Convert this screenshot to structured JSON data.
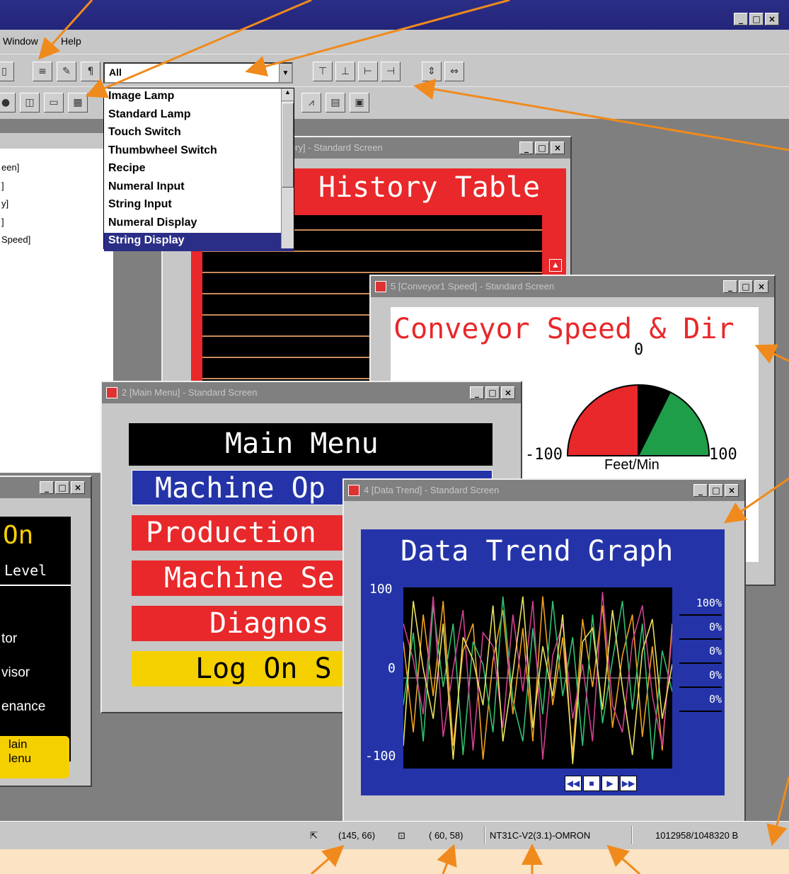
{
  "menu": {
    "window": "Window",
    "help": "Help"
  },
  "object_filter": {
    "selected": "All",
    "options": [
      "Image Lamp",
      "Standard Lamp",
      "Touch Switch",
      "Thumbwheel Switch",
      "Recipe",
      "Numeral Input",
      "String Input",
      "Numeral Display",
      "String Display"
    ],
    "highlighted": "String Display"
  },
  "screen_tree": [
    "een]",
    "]",
    "y]",
    "]",
    "Speed]"
  ],
  "windows": {
    "history": {
      "title": "ory] - Standard Screen",
      "heading": "History Table"
    },
    "conveyor": {
      "title": "5 [Conveyor1 Speed] - Standard Screen",
      "heading": "Conveyor Speed & Dir",
      "zero": "0",
      "min": "-100",
      "max": "100",
      "unit": "Feet/Min"
    },
    "main_menu": {
      "title": "2 [Main Menu] - Standard Screen",
      "heading": "Main Menu",
      "buttons": [
        "Machine Op",
        "Production",
        "Machine Se",
        "Diagnos",
        "Log On S"
      ]
    },
    "logon": {
      "heading": "On",
      "subtitle": "Level",
      "items": [
        "tor",
        "visor",
        "enance"
      ],
      "button_line1": "lain",
      "button_line2": "lenu"
    },
    "trend": {
      "title": "4 [Data Trend] - Standard Screen",
      "heading": "Data Trend Graph",
      "y_top": "100",
      "y_mid": "0",
      "y_bottom": "-100",
      "readouts": [
        "100%",
        "0%",
        "0%",
        "0%",
        "0%"
      ]
    }
  },
  "status": {
    "cursor": "(145, 66)",
    "size": "( 60, 58)",
    "model": "NT31C-V2(3.1)-OMRON",
    "memory": "1012958/1048320 B"
  },
  "colors": {
    "title_active": "#23257a",
    "callout": "#f08a1c",
    "panel_red": "#e8282a",
    "panel_blue": "#2434a8",
    "panel_yellow": "#f5d000"
  },
  "chart_data": {
    "type": "line",
    "title": "Data Trend Graph",
    "ylim": [
      -100,
      100
    ],
    "series": [
      {
        "values": [
          40,
          -60,
          70,
          -20,
          85,
          -75,
          30,
          60,
          -90,
          20,
          75,
          -40,
          55,
          -70,
          90,
          -30,
          45,
          -85,
          65,
          -10,
          80,
          -55,
          25,
          70,
          -65,
          35,
          -80,
          60
        ]
      },
      {
        "values": [
          -30,
          50,
          -70,
          80,
          -10,
          60,
          -85,
          40,
          15,
          -60,
          90,
          -25,
          -70,
          55,
          -40,
          85,
          -20,
          45,
          -75,
          70,
          -50,
          20,
          85,
          -35,
          60,
          -90,
          30,
          -15
        ]
      },
      {
        "values": [
          60,
          20,
          -40,
          90,
          -65,
          10,
          75,
          -80,
          50,
          35,
          -55,
          70,
          -15,
          85,
          -90,
          25,
          60,
          -45,
          15,
          -70,
          95,
          -30,
          -60,
          40,
          80,
          -20,
          -75,
          50
        ]
      },
      {
        "values": [
          -75,
          85,
          10,
          -45,
          60,
          -90,
          45,
          20,
          -30,
          80,
          -70,
          5,
          90,
          -55,
          35,
          -20,
          70,
          -95,
          40,
          55,
          -35,
          75,
          -10,
          -85,
          30,
          65,
          -45,
          15
        ]
      }
    ]
  }
}
